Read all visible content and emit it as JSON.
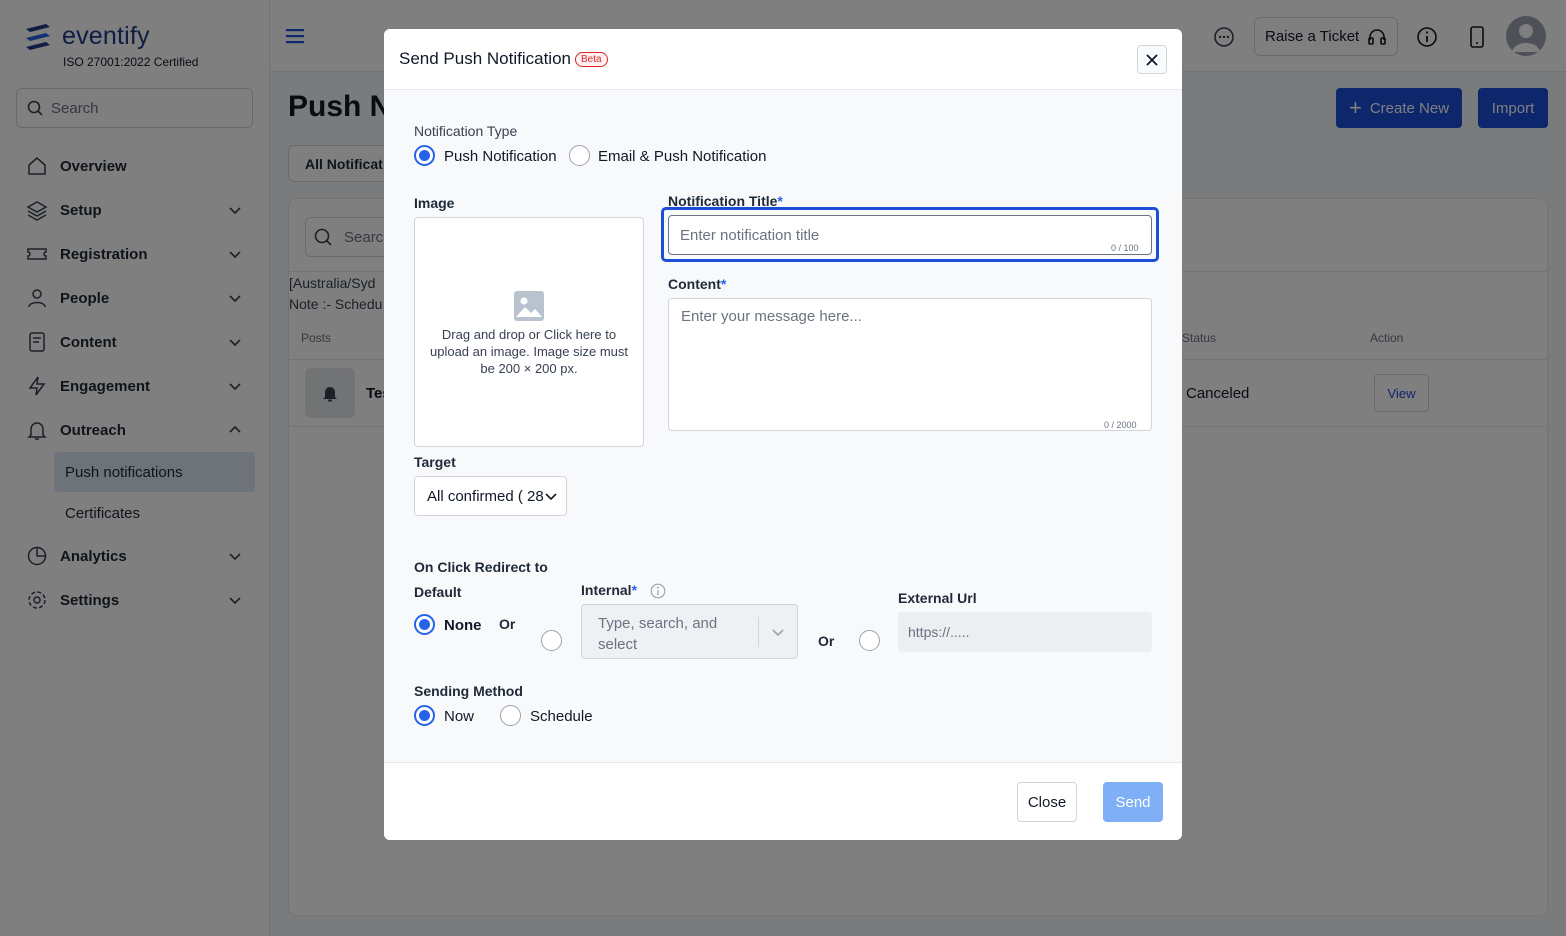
{
  "brand": {
    "name": "eventify",
    "certification": "ISO 27001:2022 Certified"
  },
  "sidebar": {
    "search_placeholder": "Search",
    "items": [
      {
        "label": "Overview",
        "icon": "home-icon"
      },
      {
        "label": "Setup",
        "icon": "layers-icon"
      },
      {
        "label": "Registration",
        "icon": "ticket-icon"
      },
      {
        "label": "People",
        "icon": "people-icon"
      },
      {
        "label": "Content",
        "icon": "document-icon"
      },
      {
        "label": "Engagement",
        "icon": "bolt-icon"
      },
      {
        "label": "Outreach",
        "icon": "bell-icon"
      }
    ],
    "outreach_sub": [
      "Push notifications",
      "Certificates"
    ],
    "items_after": [
      {
        "label": "Analytics",
        "icon": "pie-chart-icon"
      },
      {
        "label": "Settings",
        "icon": "gear-icon"
      }
    ]
  },
  "topbar": {
    "raise_ticket": "Raise a Ticket"
  },
  "page": {
    "title": "Push N",
    "create_button": "Create New",
    "import_button": "Import",
    "filter_label": "All Notificat",
    "search_placeholder": "Searc",
    "timezone_note": "[Australia/Syd",
    "schedule_note": "Note :- Schedu",
    "col_posts": "Posts",
    "col_status": "Status",
    "col_action": "Action",
    "row_title": "Tes",
    "row_status": "Canceled",
    "row_action": "View"
  },
  "modal": {
    "title": "Send Push Notification",
    "badge": "Beta",
    "notification_type_label": "Notification Type",
    "type_options": [
      "Push Notification",
      "Email & Push Notification"
    ],
    "type_selected": "Push Notification",
    "image_label": "Image",
    "upload_hint": "Drag and drop or Click here to upload an image. Image size must be 200 × 200 px.",
    "title_label": "Notification Title",
    "title_placeholder": "Enter notification title",
    "title_counter": "0 / 100",
    "content_label": "Content",
    "content_placeholder": "Enter your message here...",
    "content_counter": "0 / 2000",
    "target_label": "Target",
    "target_value": "All confirmed ( 28",
    "redirect_label": "On Click Redirect to",
    "default_label": "Default",
    "none_label": "None",
    "or_label": "Or",
    "internal_label": "Internal",
    "internal_placeholder": "Type, search, and select",
    "external_label": "External Url",
    "external_placeholder": "https://.....",
    "sending_method_label": "Sending Method",
    "sending_options": [
      "Now",
      "Schedule"
    ],
    "sending_selected": "Now",
    "close_button": "Close",
    "send_button": "Send"
  },
  "colors": {
    "primary": "#1d4ed8",
    "accent_radio": "#2563eb",
    "send_disabled": "#7fb0f5",
    "beta_red": "#dc2626"
  }
}
